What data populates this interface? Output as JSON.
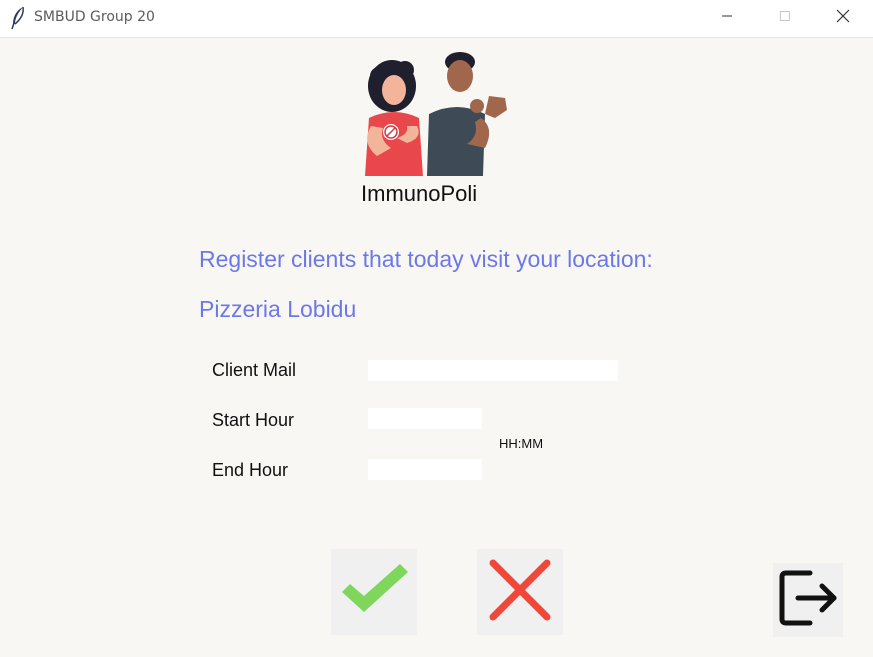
{
  "window": {
    "title": "SMBUD Group 20",
    "icons": {
      "app": "feather-icon",
      "minimize": "minimize-icon",
      "maximize": "maximize-icon",
      "close": "close-icon"
    }
  },
  "brand": {
    "logo_icon": "two-people-logo",
    "name": "ImmunoPoli"
  },
  "main": {
    "heading": "Register clients that today visit your location:",
    "location_name": "Pizzeria Lobidu"
  },
  "form": {
    "client_mail_label": "Client Mail",
    "client_mail_value": "",
    "start_hour_label": "Start Hour",
    "start_hour_value": "",
    "end_hour_label": "End Hour",
    "end_hour_value": "",
    "time_format_hint": "HH:MM"
  },
  "actions": {
    "confirm_icon": "checkmark-icon",
    "cancel_icon": "x-cross-icon",
    "logout_icon": "logout-icon"
  },
  "colors": {
    "accent_text": "#6b79e8",
    "confirm": "#7ed65b",
    "cancel": "#f0473b",
    "background": "#f9f7f4"
  }
}
